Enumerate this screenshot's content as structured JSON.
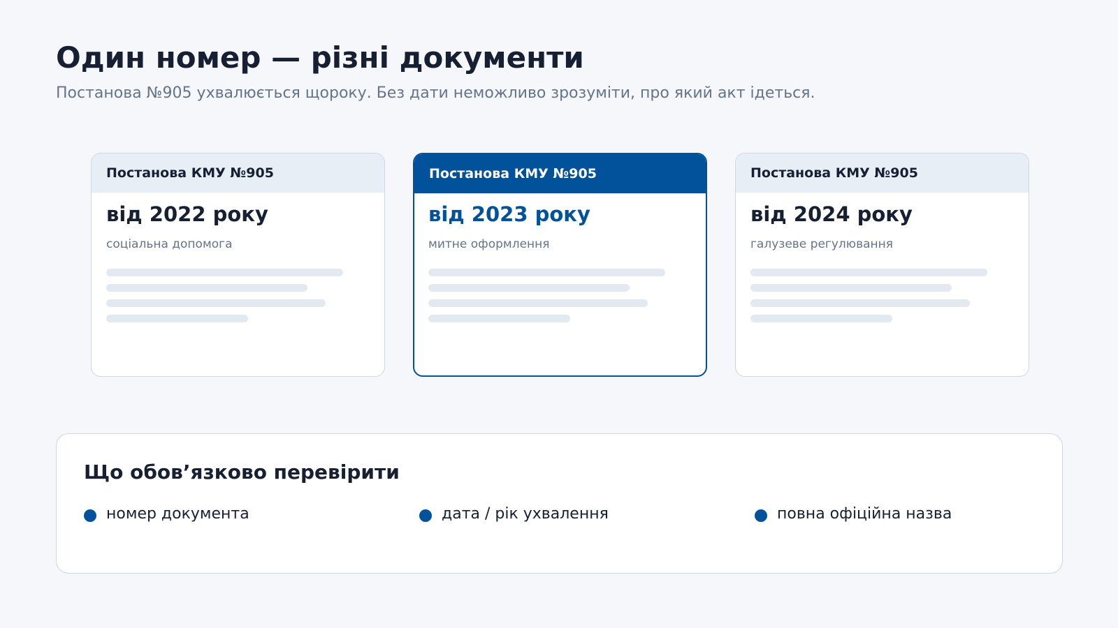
{
  "header": {
    "title": "Один номер — різні документи",
    "subtitle": "Постанова №905 ухвалюється щороку. Без дати неможливо зрозуміти, про який акт ідеться."
  },
  "cards": [
    {
      "header": "Постанова КМУ №905",
      "year": "від 2022 року",
      "category": "соціальна допомога",
      "highlighted": false
    },
    {
      "header": "Постанова КМУ №905",
      "year": "від 2023 року",
      "category": "митне оформлення",
      "highlighted": true
    },
    {
      "header": "Постанова КМУ №905",
      "year": "від 2024 року",
      "category": "галузеве регулювання",
      "highlighted": false
    }
  ],
  "checklist": {
    "title": "Що обов’язково перевірити",
    "items": [
      {
        "label": "номер документа"
      },
      {
        "label": "дата / рік ухвалення"
      },
      {
        "label": "повна офіційна назва"
      }
    ]
  },
  "colors": {
    "accent": "#02519b",
    "background": "#f5f7fb",
    "card_header_bg": "#e8eef6",
    "skeleton": "#e3e9f1",
    "muted_text": "#64748b",
    "text": "#172033"
  }
}
